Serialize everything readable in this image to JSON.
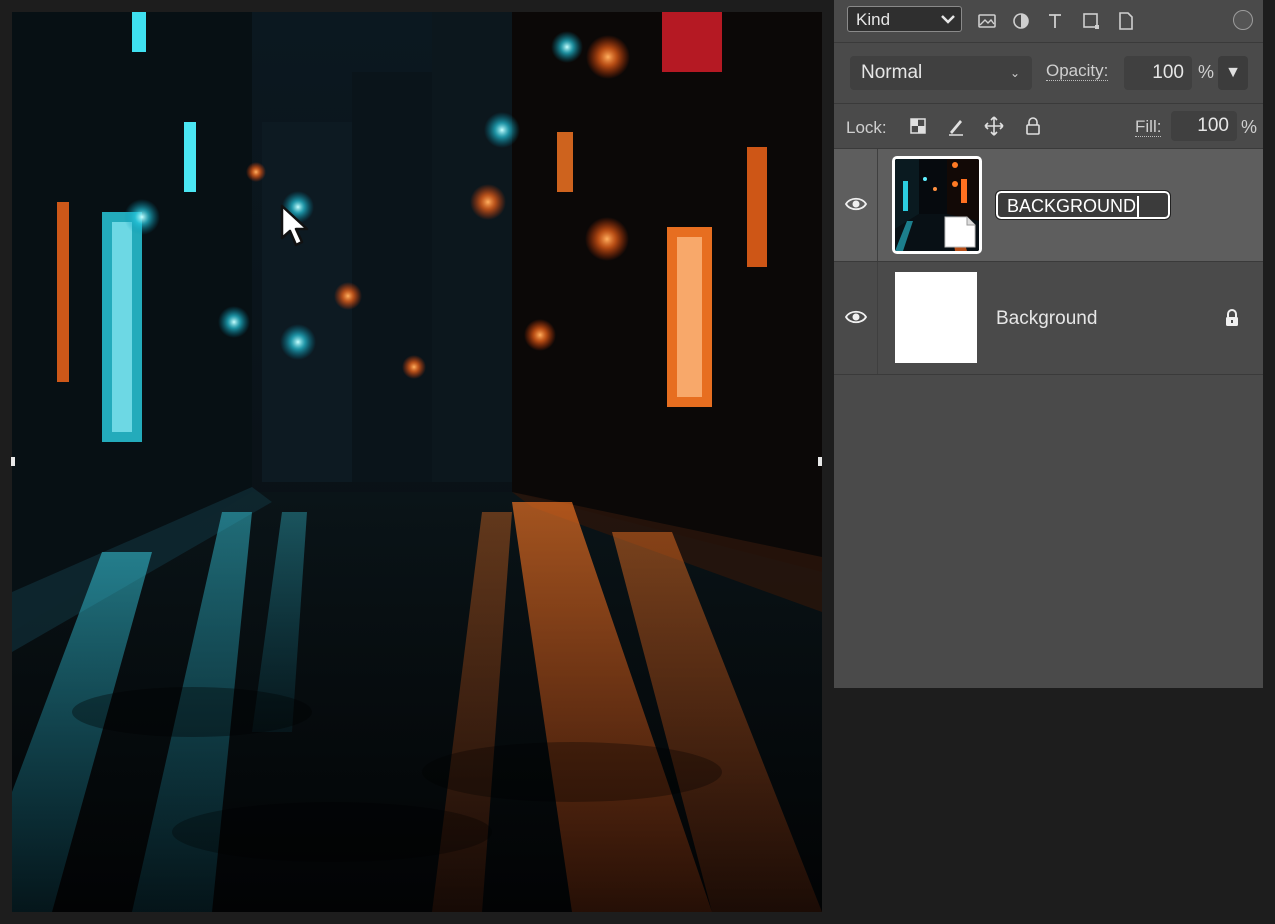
{
  "layers_panel": {
    "filter": {
      "kind_label": "Kind",
      "icons": [
        "image-filter-icon",
        "adjustment-filter-icon",
        "type-filter-icon",
        "shape-filter-icon",
        "smart-object-filter-icon"
      ]
    },
    "blend_mode": "Normal",
    "opacity_label": "Opacity:",
    "opacity_value": "100",
    "opacity_unit": "%",
    "lock_label": "Lock:",
    "fill_label": "Fill:",
    "fill_value": "100",
    "fill_unit": "%",
    "layers": [
      {
        "name": "BACKGROUND",
        "visible": true,
        "selected": true,
        "editing": true,
        "thumbnail": "night-street-photo"
      },
      {
        "name": "Background",
        "visible": true,
        "selected": false,
        "locked": true,
        "thumbnail": "white-fill"
      }
    ]
  },
  "colors": {
    "panel_bg": "#4a4a4a",
    "selected_row": "#5e5e5e",
    "app_bg": "#1d1d1d"
  }
}
